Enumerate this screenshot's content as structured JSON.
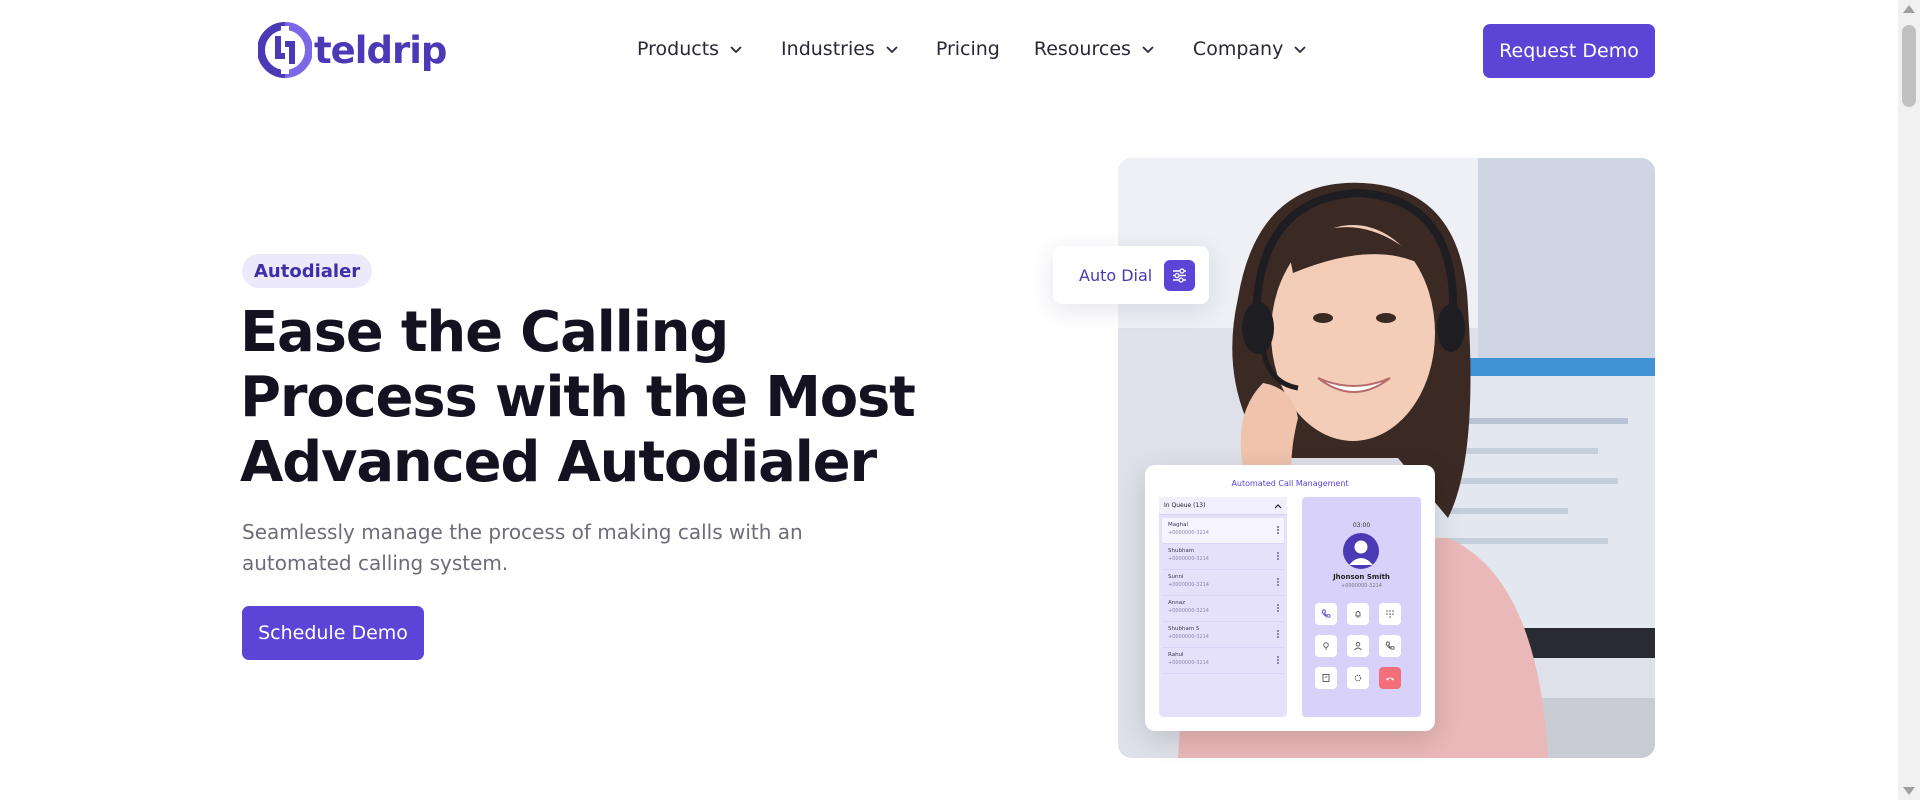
{
  "brand": {
    "name": "teldrip",
    "color": "#4a3ab5"
  },
  "nav": {
    "items": [
      {
        "label": "Products",
        "has_dropdown": true
      },
      {
        "label": "Industries",
        "has_dropdown": true
      },
      {
        "label": "Pricing",
        "has_dropdown": false
      },
      {
        "label": "Resources",
        "has_dropdown": true
      },
      {
        "label": "Company",
        "has_dropdown": true
      }
    ],
    "cta_label": "Request Demo"
  },
  "hero": {
    "badge": "Autodialer",
    "title": "Ease the Calling Process with the Most Advanced Autodialer",
    "subtitle": "Seamlessly manage the process of making calls with an automated calling system.",
    "cta_label": "Schedule Demo"
  },
  "widget": {
    "auto_dial_label": "Auto Dial",
    "card_title": "Automated Call Management",
    "queue_header": "In Queue (13)",
    "queue": [
      {
        "name": "Maghal",
        "number": "+0000000-3214"
      },
      {
        "name": "Shubham",
        "number": "+0000000-3214"
      },
      {
        "name": "Sunni",
        "number": "+0000000-3214"
      },
      {
        "name": "Annaz",
        "number": "+0000000-3214"
      },
      {
        "name": "Shubham S",
        "number": "+0000000-3214"
      },
      {
        "name": "Rahul",
        "number": "+0000000-3214"
      }
    ],
    "call_timer": "03:00",
    "caller_name": "Jhonson Smith",
    "caller_number": "+0000000-3214",
    "call_buttons": [
      "phone-icon",
      "bell-icon",
      "keypad-icon",
      "location-icon",
      "user-icon",
      "call-forward-icon",
      "notes-icon",
      "settings-icon",
      "end-call-icon"
    ]
  },
  "colors": {
    "accent": "#5b44d6",
    "badge_bg": "#ece9fb",
    "end_call": "#f2707a"
  }
}
